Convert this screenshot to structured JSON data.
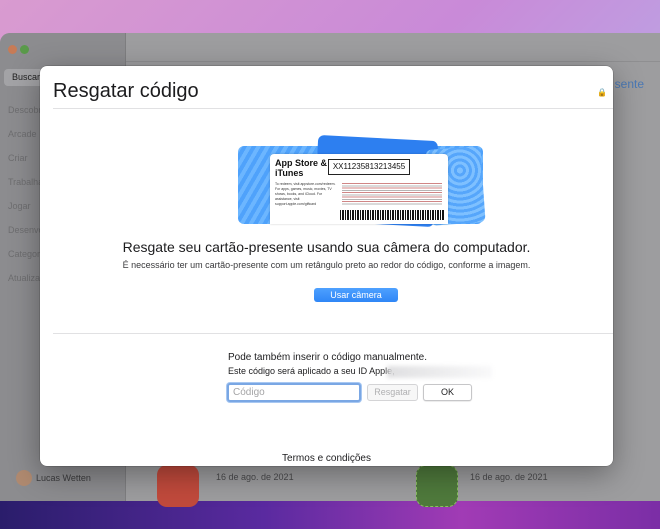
{
  "background_app": {
    "sidebar": {
      "search_label": "Buscar",
      "items": [
        "Descobrir",
        "Arcade",
        "Criar",
        "Trabalhar",
        "Jogar",
        "Desenvolver",
        "Categorias",
        "Atualizações"
      ],
      "user_name": "Lucas Wetten"
    },
    "main": {
      "link_text": "sente",
      "dates": [
        "16 de ago. de 2021",
        "16 de ago. de 2021"
      ]
    }
  },
  "dialog": {
    "title": "Resgatar código",
    "gift_card": {
      "brand": "App Store & iTunes",
      "sample_code": "XX11235813213455",
      "fine_text": "To redeem, visit appstore.com/redeem. For apps, games, music, movies, TV shows, books, and iCloud. For assistance, visit support.apple.com/giftcard"
    },
    "camera_section": {
      "headline": "Resgate seu cartão-presente usando sua câmera do computador.",
      "instruction": "É necessário ter um cartão-presente com um retângulo preto ao redor do código, conforme a imagem.",
      "camera_button": "Usar câmera"
    },
    "manual_section": {
      "title": "Pode também inserir o código manualmente.",
      "subtitle": "Este código será aplicado a seu ID Apple,",
      "code_placeholder": "Código",
      "code_value": "",
      "redeem_button": "Resgatar",
      "ok_button": "OK"
    },
    "terms_link": "Termos e condições"
  },
  "colors": {
    "accent": "#2f86f6",
    "focus_ring": "#7aa7e4"
  }
}
